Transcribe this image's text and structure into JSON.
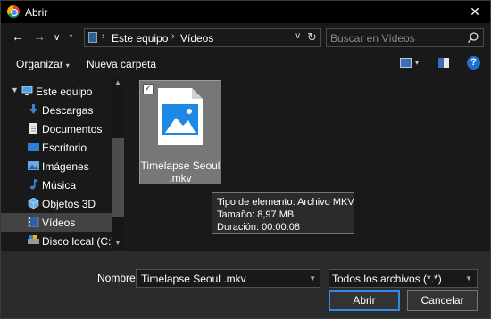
{
  "window": {
    "title": "Abrir"
  },
  "nav": {
    "back": "←",
    "forward": "→",
    "recent": "∨",
    "up": "↑"
  },
  "address": {
    "segments": [
      "Este equipo",
      "Vídeos"
    ],
    "separator": "›",
    "dropdown": "∨",
    "refresh": "↻"
  },
  "search": {
    "placeholder": "Buscar en Vídeos"
  },
  "toolbar": {
    "organize": "Organizar",
    "new_folder": "Nueva carpeta",
    "help": "?"
  },
  "sidebar": {
    "items": [
      {
        "label": "Este equipo",
        "icon": "computer-icon",
        "color": "#4aa3e8"
      },
      {
        "label": "Descargas",
        "icon": "download-icon",
        "color": "#3b82d6"
      },
      {
        "label": "Documentos",
        "icon": "document-icon",
        "color": "#d9d9d9"
      },
      {
        "label": "Escritorio",
        "icon": "desktop-icon",
        "color": "#2b7fd4"
      },
      {
        "label": "Imágenes",
        "icon": "pictures-icon",
        "color": "#6aa7e8"
      },
      {
        "label": "Música",
        "icon": "music-icon",
        "color": "#3b82d6"
      },
      {
        "label": "Objetos 3D",
        "icon": "3d-objects-icon",
        "color": "#5fb0f0"
      },
      {
        "label": "Vídeos",
        "icon": "videos-icon",
        "color": "#2b5fa6",
        "selected": true
      },
      {
        "label": "Disco local (C:)",
        "icon": "drive-icon",
        "color": "#9a9a9a"
      }
    ]
  },
  "file": {
    "name_line1": "Timelapse Seoul",
    "name_line2": ".mkv",
    "checked": true,
    "check_mark": "✓"
  },
  "tooltip": {
    "type": "Tipo de elemento: Archivo MKV",
    "size": "Tamaño: 8,97 MB",
    "duration": "Duración: 00:00:08"
  },
  "footer": {
    "filename_label": "Nombre:",
    "filename_value": "Timelapse Seoul .mkv",
    "filter_value": "Todos los archivos (*.*)",
    "open_button": "Abrir",
    "cancel_button": "Cancelar"
  },
  "colors": {
    "accent": "#2e8be6",
    "selected_bg": "#434343",
    "dialog_bg": "#191919",
    "footer_bg": "#2b2b2b"
  }
}
